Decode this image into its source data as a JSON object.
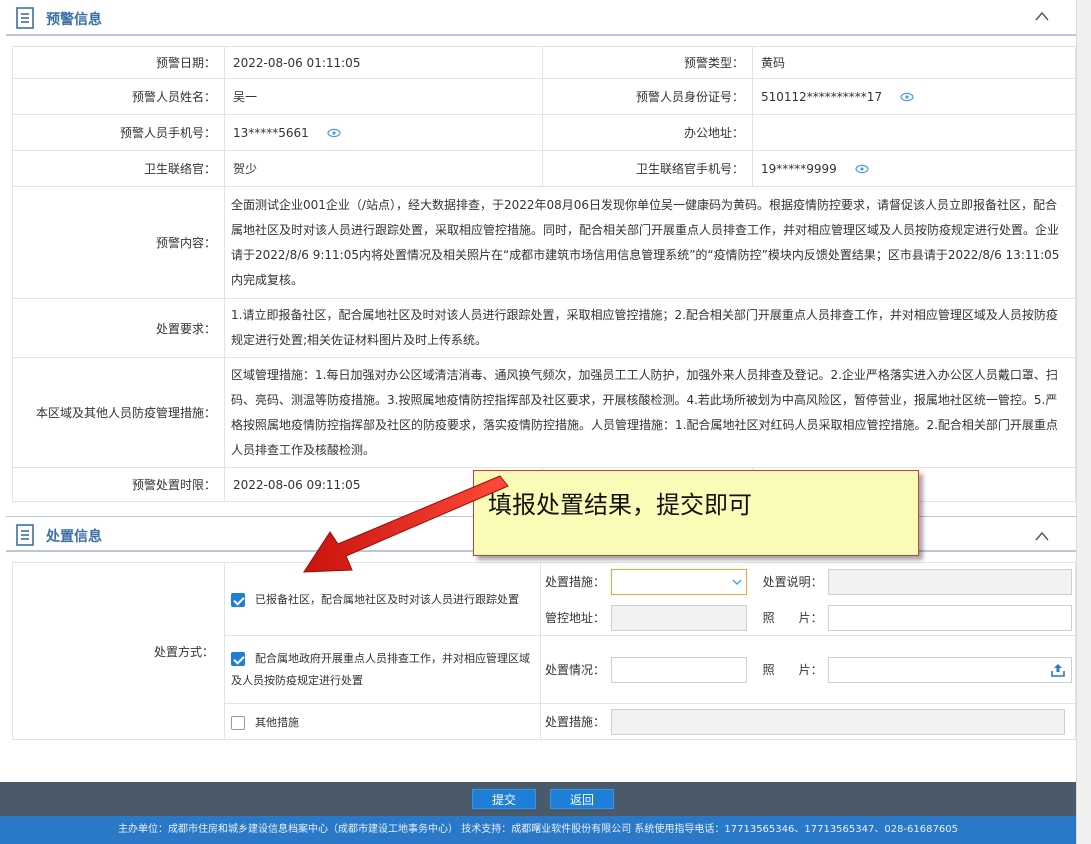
{
  "warning_section": {
    "title": "预警信息",
    "rows": {
      "date_label": "预警日期：",
      "date_value": "2022-08-06 01:11:05",
      "type_label": "预警类型：",
      "type_value": "黄码",
      "name_label": "预警人员姓名：",
      "name_value": "吴一",
      "id_label": "预警人员身份证号：",
      "id_value": "510112**********17",
      "phone_label": "预警人员手机号：",
      "phone_value": "13*****5661",
      "office_label": "办公地址：",
      "office_value": "",
      "liaison_label": "卫生联络官：",
      "liaison_value": "贺少",
      "liaison_phone_label": "卫生联络官手机号：",
      "liaison_phone_value": "19*****9999",
      "content_label": "预警内容：",
      "content_value": "全面测试企业001企业（/站点），经大数据排查，于2022年08月06日发现你单位吴一健康码为黄码。根据疫情防控要求，请督促该人员立即报备社区，配合属地社区及时对该人员进行跟踪处置，采取相应管控措施。同时，配合相关部门开展重点人员排查工作，并对相应管理区域及人员按防疫规定进行处置。企业请于2022/8/6 9:11:05内将处置情况及相关照片在“成都市建筑市场信用信息管理系统”的“疫情防控”模块内反馈处置结果；区市县请于2022/8/6 13:11:05内完成复核。",
      "require_label": "处置要求：",
      "require_value": "1.请立即报备社区，配合属地社区及时对该人员进行跟踪处置，采取相应管控措施；2.配合相关部门开展重点人员排查工作，并对相应管理区域及人员按防疫规定进行处置;相关佐证材料图片及时上传系统。",
      "measures_label": "本区域及其他人员防疫管理措施：",
      "measures_value": "区域管理措施：1.每日加强对办公区域清洁消毒、通风换气频次，加强员工工人防护，加强外来人员排查及登记。2.企业严格落实进入办公区人员戴口罩、扫码、亮码、测温等防疫措施。3.按照属地疫情防控指挥部及社区要求，开展核酸检测。4.若此场所被划为中高风险区，暂停营业，报属地社区统一管控。5.严格按照属地疫情防控指挥部及社区的防疫要求，落实疫情防控措施。人员管理措施：1.配合属地社区对红码人员采取相应管控措施。2.配合相关部门开展重点人员排查工作及核酸检测。",
      "deadline_label": "预警处置时限：",
      "deadline_value": "2022-08-06 09:11:05"
    }
  },
  "disposal_section": {
    "title": "处置信息",
    "method_label": "处置方式：",
    "option1": "已报备社区，配合属地社区及时对该人员进行跟踪处置",
    "option2": "配合属地政府开展重点人员排查工作，并对相应管理区域及人员按防疫规定进行处置",
    "option3": "其他措施",
    "measure_label": "处置措施：",
    "note_label": "处置说明：",
    "address_label": "管控地址：",
    "photo_label": "照　　片：",
    "situation_label": "处置情况：",
    "measure2_label": "处置措施："
  },
  "callout": {
    "text": "填报处置结果，提交即可"
  },
  "footer": {
    "submit": "提交",
    "back": "返回",
    "info": "主办单位：成都市住房和城乡建设信息档案中心（成都市建设工地事务中心）   技术支持：成都曙业软件股份有限公司   系统使用指导电话：17713565346、17713565347、028-61687605"
  },
  "colors": {
    "accent": "#3b6fa8",
    "primary_button": "#1e7fd8",
    "footer_bar": "#4a5a6a",
    "footer_info": "#2a79c9",
    "callout_bg": "#fbfbb8",
    "arrow": "#e0231c"
  }
}
